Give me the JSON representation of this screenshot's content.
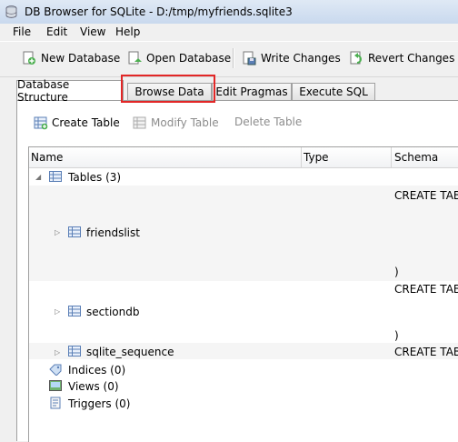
{
  "window": {
    "title": "DB Browser for SQLite - D:/tmp/myfriends.sqlite3"
  },
  "menu": [
    "File",
    "Edit",
    "View",
    "Help"
  ],
  "toolbar": {
    "new_database": "New Database",
    "open_database": "Open Database",
    "write_changes": "Write Changes",
    "revert_changes": "Revert Changes"
  },
  "tabs": [
    {
      "label": "Database Structure",
      "active": true
    },
    {
      "label": "Browse Data",
      "active": false,
      "highlighted": true
    },
    {
      "label": "Edit Pragmas",
      "active": false
    },
    {
      "label": "Execute SQL",
      "active": false
    }
  ],
  "structure_toolbar": {
    "create_table": "Create Table",
    "modify_table": "Modify Table",
    "delete_table": "Delete Table"
  },
  "tree": {
    "columns": [
      "Name",
      "Type",
      "Schema"
    ],
    "tables_label": "Tables (3)",
    "tables": [
      {
        "name": "friendslist",
        "schema_first": "CREATE TABL",
        "schema_last": ")"
      },
      {
        "name": "sectiondb",
        "schema_first": "CREATE TABL",
        "schema_last": ")"
      },
      {
        "name": "sqlite_sequence",
        "schema_first": "CREATE TABL"
      }
    ],
    "indices_label": "Indices (0)",
    "views_label": "Views (0)",
    "triggers_label": "Triggers (0)"
  },
  "colors": {
    "highlight_border": "#e22727",
    "titlebar": "#dfe9f5"
  }
}
